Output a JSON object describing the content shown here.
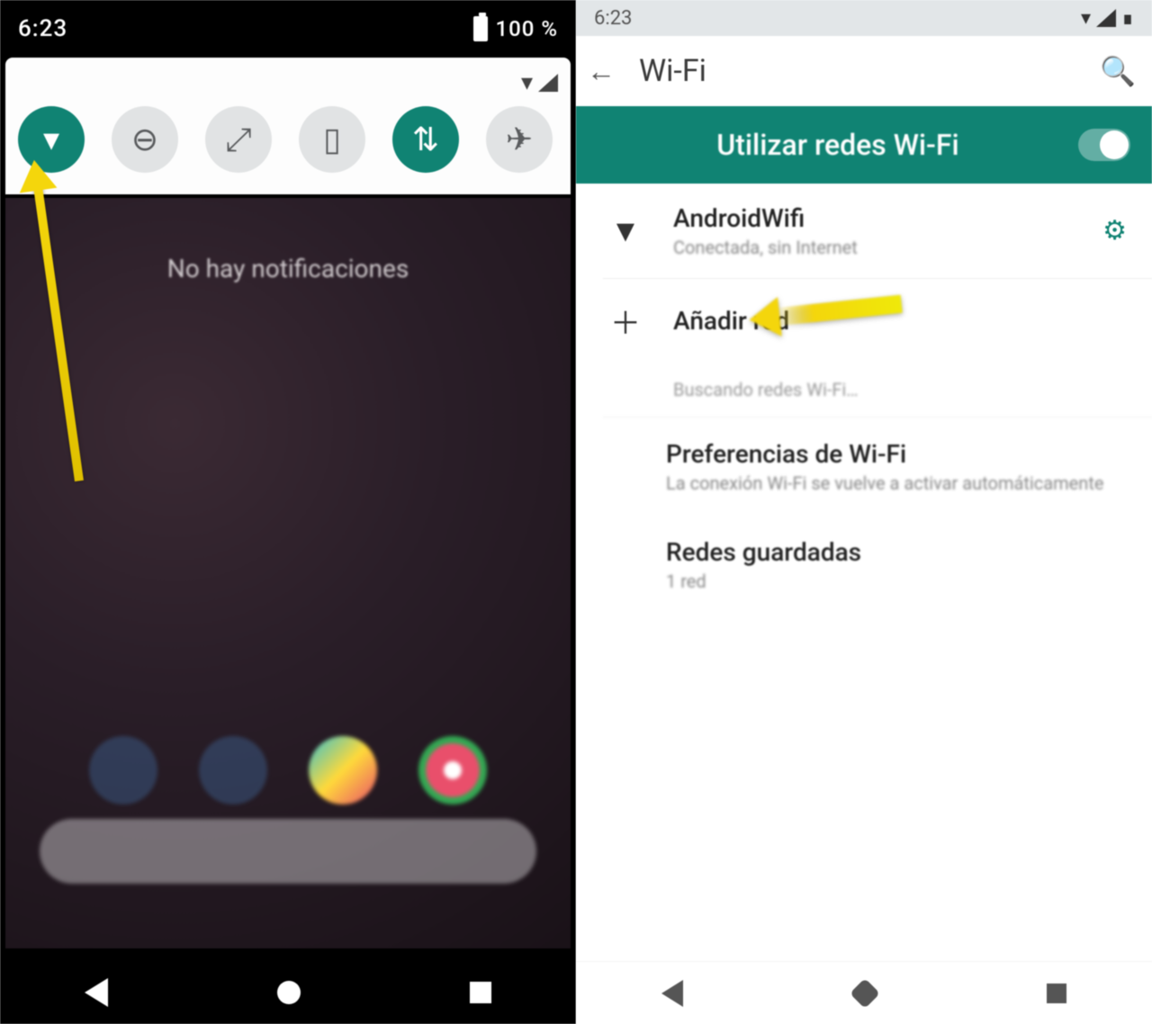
{
  "left": {
    "status": {
      "time": "6:23",
      "battery": "100 %"
    },
    "quick_settings": {
      "carrier": "",
      "tiles": [
        {
          "name": "wifi",
          "glyph": "▾",
          "active": true
        },
        {
          "name": "dnd",
          "glyph": "⊖",
          "active": false
        },
        {
          "name": "auto-rotate",
          "glyph": "⤢",
          "active": false
        },
        {
          "name": "battery",
          "glyph": "▯",
          "active": false
        },
        {
          "name": "mobile-data",
          "glyph": "⇅",
          "active": true
        },
        {
          "name": "airplane",
          "glyph": "✈",
          "active": false
        }
      ]
    },
    "no_notifications": "No hay notificaciones",
    "dock": [
      "phone",
      "messages",
      "play-store",
      "chrome"
    ]
  },
  "right": {
    "status": {
      "time": "6:23"
    },
    "appbar": {
      "title": "Wi-Fi"
    },
    "toggle": {
      "label": "Utilizar redes Wi-Fi",
      "on": true
    },
    "networks": [
      {
        "ssid": "AndroidWifi",
        "subtitle": "Conectada, sin Internet"
      }
    ],
    "add_network": "Añadir red",
    "scan_hint": "Buscando redes Wi-Fi…",
    "prefs": {
      "title": "Preferencias de Wi-Fi",
      "subtitle": "La conexión Wi-Fi se vuelve a activar automáticamente"
    },
    "saved": {
      "title": "Redes guardadas",
      "subtitle": "1 red"
    }
  }
}
